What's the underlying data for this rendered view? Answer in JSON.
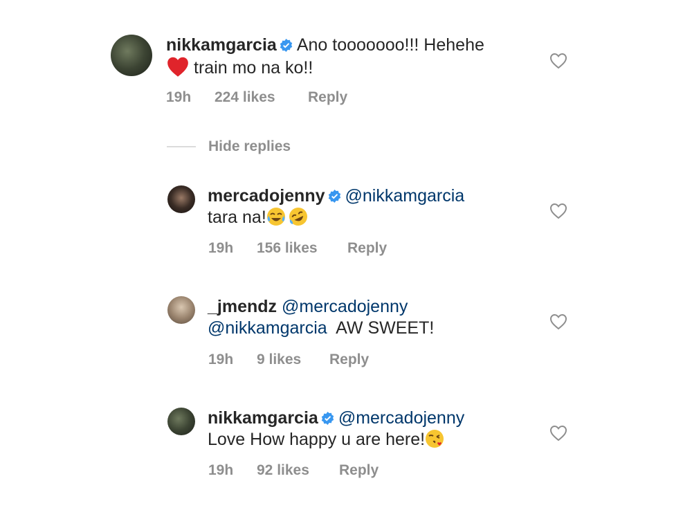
{
  "comments": [
    {
      "username": "nikkamgarcia",
      "verified": true,
      "mention": "",
      "text_line1": "Ano tooooooo!!! Hehehe",
      "emoji": "red-heart",
      "text_line2": "train mo na ko!!",
      "time": "19h",
      "likes": "224 likes",
      "reply_label": "Reply"
    },
    {
      "username": "mercadojenny",
      "verified": true,
      "mention": "@nikkamgarcia",
      "text": "tara na!",
      "emoji1": "face-with-tears-of-joy",
      "emoji2": "rolling-on-the-floor-laughing",
      "time": "19h",
      "likes": "156 likes",
      "reply_label": "Reply"
    },
    {
      "username": "_jmendz",
      "verified": false,
      "mention": "@mercadojenny",
      "mention2": "@nikkamgarcia",
      "text": "AW SWEET!",
      "time": "19h",
      "likes": "9 likes",
      "reply_label": "Reply"
    },
    {
      "username": "nikkamgarcia",
      "verified": true,
      "mention": "@mercadojenny",
      "text": "Love How happy u are here!",
      "emoji": "face-blowing-a-kiss",
      "time": "19h",
      "likes": "92 likes",
      "reply_label": "Reply"
    }
  ],
  "hide_replies_label": "Hide replies",
  "colors": {
    "text": "#262626",
    "mention": "#00376b",
    "meta": "#8e8e8e",
    "verified": "#3897f0",
    "divider": "#dbdbdb"
  }
}
